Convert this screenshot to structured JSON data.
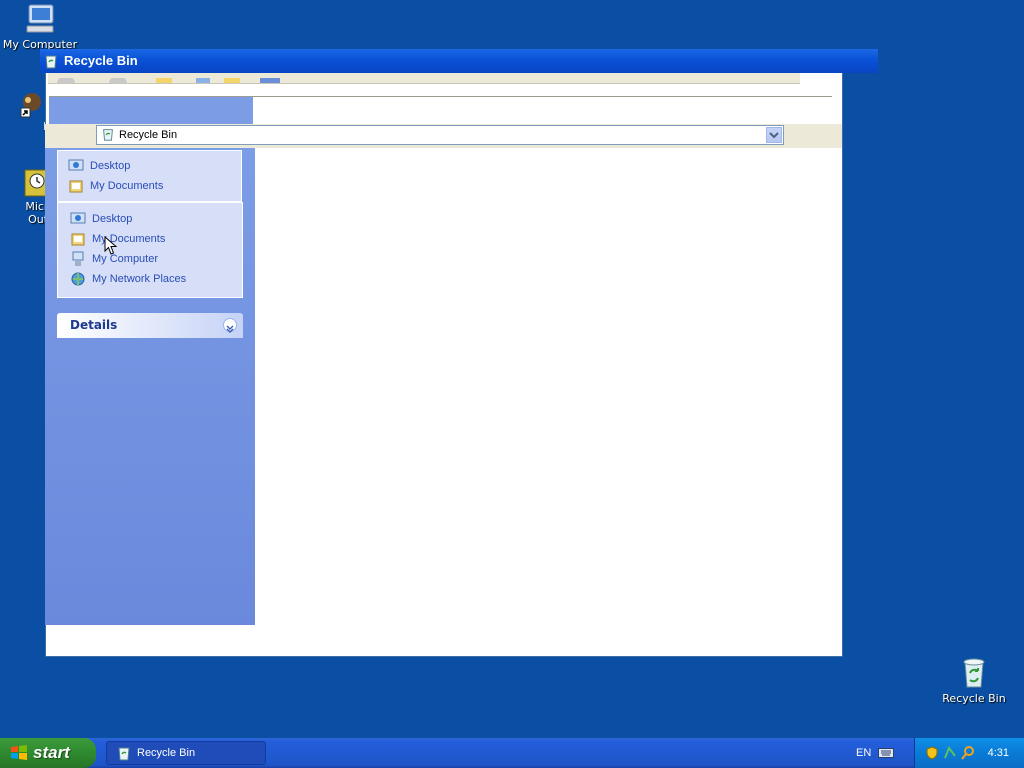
{
  "desktop": {
    "icons": [
      {
        "label": "My Computer",
        "icon": "my-computer-icon"
      },
      {
        "label": "MyPa",
        "icon": "mypaint-shortcut-icon"
      },
      {
        "label": "Micros\nOutlo",
        "icon": "outlook-shortcut-icon"
      },
      {
        "label": "Recycle Bin",
        "icon": "recycle-bin-icon"
      }
    ]
  },
  "window": {
    "title": "Recycle Bin",
    "address": {
      "value": "Recycle Bin"
    }
  },
  "taskpane": {
    "panel_top": {
      "items": [
        {
          "label": "Desktop",
          "icon": "desktop-icon"
        },
        {
          "label": "My Documents",
          "icon": "my-documents-icon"
        }
      ]
    },
    "other_places": {
      "items": [
        {
          "label": "Desktop",
          "icon": "desktop-icon"
        },
        {
          "label": "My Documents",
          "icon": "my-documents-icon"
        },
        {
          "label": "My Computer",
          "icon": "my-computer-icon"
        },
        {
          "label": "My Network Places",
          "icon": "my-network-places-icon"
        }
      ]
    },
    "details": {
      "title": "Details"
    }
  },
  "taskbar": {
    "start_label": "start",
    "task_button": "Recycle Bin",
    "language": "EN",
    "clock": "4:31"
  },
  "colors": {
    "desktop": "#0a4fa3",
    "titlebar": "#0a53d8",
    "taskpane": "#7b9ce6",
    "link": "#2a4db8",
    "start": "#2f8a2f"
  }
}
